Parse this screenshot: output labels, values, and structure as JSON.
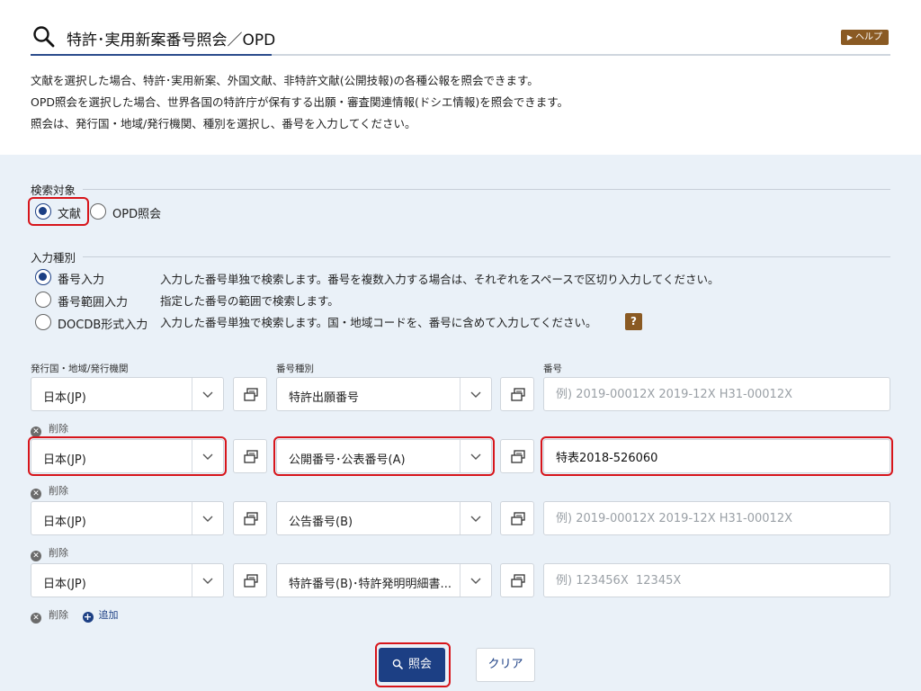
{
  "header": {
    "title": "特許･実用新案番号照会／OPD",
    "help_label": "ヘルプ"
  },
  "description": [
    "文献を選択した場合、特許･実用新案、外国文献、非特許文献(公開技報)の各種公報を照会できます。",
    "OPD照会を選択した場合、世界各国の特許庁が保有する出願・審査関連情報(ドシエ情報)を照会できます。",
    "照会は、発行国・地域/発行機関、種別を選択し、番号を入力してください。"
  ],
  "search_target": {
    "label": "検索対象",
    "options": [
      {
        "label": "文献",
        "selected": true
      },
      {
        "label": "OPD照会",
        "selected": false
      }
    ]
  },
  "input_type": {
    "label": "入力種別",
    "options": [
      {
        "label": "番号入力",
        "desc": "入力した番号単独で検索します。番号を複数入力する場合は、それぞれをスペースで区切り入力してください。",
        "selected": true
      },
      {
        "label": "番号範囲入力",
        "desc": "指定した番号の範囲で検索します。",
        "selected": false
      },
      {
        "label": "DOCDB形式入力",
        "desc": "入力した番号単独で検索します。国・地域コードを、番号に含めて入力してください。",
        "selected": false
      }
    ],
    "help_mark": "?"
  },
  "columns": {
    "country": "発行国・地域/発行機関",
    "kind": "番号種別",
    "number": "番号"
  },
  "rows": [
    {
      "country": "日本(JP)",
      "kind": "特許出願番号",
      "value": "",
      "placeholder": "例) 2019-00012X 2019-12X H31-00012X"
    },
    {
      "country": "日本(JP)",
      "kind": "公開番号･公表番号(A)",
      "value": "特表2018-526060",
      "placeholder": ""
    },
    {
      "country": "日本(JP)",
      "kind": "公告番号(B)",
      "value": "",
      "placeholder": "例) 2019-00012X 2019-12X H31-00012X"
    },
    {
      "country": "日本(JP)",
      "kind": "特許番号(B)･特許発明明細書...",
      "value": "",
      "placeholder": "例) 123456X  12345X"
    }
  ],
  "row_actions": {
    "delete_label": "削除",
    "add_label": "追加"
  },
  "actions": {
    "search_label": "照会",
    "clear_label": "クリア"
  },
  "colors": {
    "accent": "#1c3f84",
    "help": "#8a5a23",
    "highlight": "#d7151b",
    "panel_bg": "#eaf1f8"
  }
}
